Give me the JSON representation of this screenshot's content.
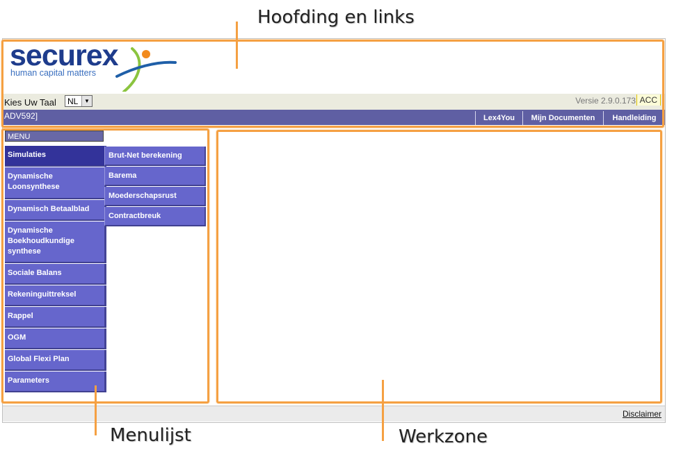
{
  "annotations": {
    "header_label": "Hoofding en links",
    "menu_label": "Menulijst",
    "workzone_label": "Werkzone"
  },
  "brand": {
    "name": "securex",
    "tagline": "human capital matters"
  },
  "language": {
    "label": "Kies Uw Taal",
    "selected": "NL"
  },
  "version": {
    "text": "Versie 2.9.0.173",
    "env": "ACC"
  },
  "user": {
    "code": "ADV592]"
  },
  "top_links": [
    "Lex4You",
    "Mijn Documenten",
    "Handleiding"
  ],
  "menu": {
    "header": "MENU",
    "items": [
      "Simulaties",
      "Dynamische Loonsynthese",
      "Dynamisch Betaalblad",
      "Dynamische Boekhoudkundige synthese",
      "Sociale Balans",
      "Rekeninguittreksel",
      "Rappel",
      "OGM",
      "Global Flexi Plan",
      "Parameters"
    ],
    "submenu": [
      "Brut-Net berekening",
      "Barema",
      "Moederschapsrust",
      "Contractbreuk"
    ]
  },
  "footer": {
    "disclaimer": "Disclaimer"
  },
  "colors": {
    "accent": "#f5a042",
    "nav_bg": "#5f5fa3",
    "menu_bg": "#6666cc",
    "menu_active": "#33339a"
  }
}
